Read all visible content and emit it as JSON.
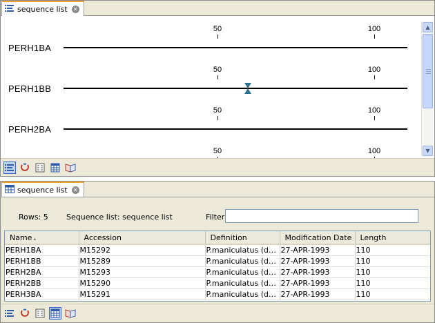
{
  "top_panel": {
    "tab_label": "sequence list",
    "sequences": [
      {
        "name": "PERH1BA",
        "ticks": [
          "50",
          "100"
        ],
        "cursor": false
      },
      {
        "name": "PERH1BB",
        "ticks": [
          "50",
          "100"
        ],
        "cursor": true
      },
      {
        "name": "PERH2BA",
        "ticks": [
          "50",
          "100"
        ],
        "cursor": false
      },
      {
        "name": "",
        "ticks": [
          "50",
          "100"
        ],
        "cursor": false
      }
    ],
    "toolbar_icons": [
      "sequence-view-icon",
      "circular-view-icon",
      "text-view-icon",
      "table-view-icon",
      "history-icon"
    ]
  },
  "bottom_panel": {
    "tab_label": "sequence list",
    "rows_label": "Rows: 5",
    "list_label": "Sequence list: sequence list",
    "filter_label": "Filter:",
    "filter_value": "",
    "columns": [
      "Name",
      "Accession",
      "Definition",
      "Modification Date",
      "Length"
    ],
    "sort_indicator": "▴",
    "rows": [
      [
        "PERH1BA",
        "M15292",
        "P.maniculatus (deer mouse) beta-globin",
        "27-APR-1993",
        "110"
      ],
      [
        "PERH1BB",
        "M15289",
        "P.maniculatus (deer mouse) beta-globin",
        "27-APR-1993",
        "110"
      ],
      [
        "PERH2BA",
        "M15293",
        "P.maniculatus (deer mouse) beta-globin",
        "27-APR-1993",
        "110"
      ],
      [
        "PERH2BB",
        "M15290",
        "P.maniculatus (deer mouse) beta-globin",
        "27-APR-1993",
        "110"
      ],
      [
        "PERH3BA",
        "M15291",
        "P.maniculatus (deer mouse) beta-globin",
        "27-APR-1993",
        "110"
      ]
    ],
    "toolbar_icons": [
      "sequence-view-icon",
      "circular-view-icon",
      "text-view-icon",
      "table-view-icon",
      "history-icon"
    ]
  },
  "colors": {
    "tab_highlight": "#f0a030",
    "panel_bg": "#ece9d8",
    "cursor_marker": "#2c6e8f"
  }
}
